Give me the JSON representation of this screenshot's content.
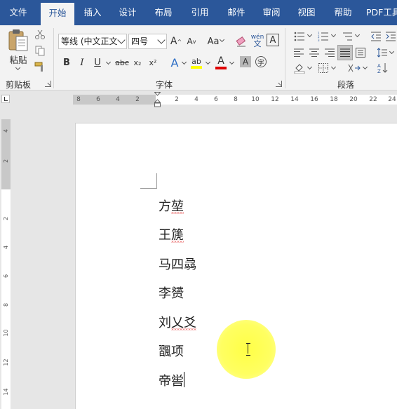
{
  "tabs": [
    "文件",
    "开始",
    "插入",
    "设计",
    "布局",
    "引用",
    "邮件",
    "审阅",
    "视图",
    "帮助",
    "PDF工具"
  ],
  "active_tab": "开始",
  "clipboard": {
    "paste_label": "粘贴",
    "group_label": "剪贴板"
  },
  "font": {
    "font_name": "等线 (中文正文",
    "font_size": "四号",
    "group_label": "字体",
    "grow_label": "A",
    "shrink_label": "A",
    "case_label": "Aa",
    "bold": "B",
    "italic": "I",
    "underline": "U",
    "strike": "abc",
    "subscript": "x₂",
    "superscript": "x²",
    "pinyin_top": "wén",
    "pinyin_bottom": "文",
    "char_border": "A",
    "effects": "A",
    "highlight": "ab",
    "font_color": "A",
    "shading": "A",
    "enclose": "字",
    "colors": {
      "highlight": "#ffff00",
      "font_color": "#e00000"
    }
  },
  "paragraph": {
    "group_label": "段落"
  },
  "ruler": {
    "left_ticks": [
      "8",
      "6",
      "4",
      "2"
    ],
    "right_ticks": [
      "2",
      "4",
      "6",
      "8",
      "10",
      "12",
      "14",
      "16",
      "18",
      "20",
      "22",
      "24"
    ],
    "vertical_ticks": [
      "4",
      "2",
      "2",
      "4",
      "6",
      "8",
      "10",
      "12",
      "14"
    ]
  },
  "document": {
    "lines": [
      "方堃",
      "王篪",
      "马四骉",
      "李赟",
      "刘乂爻",
      "飁项",
      "帝喾"
    ]
  }
}
